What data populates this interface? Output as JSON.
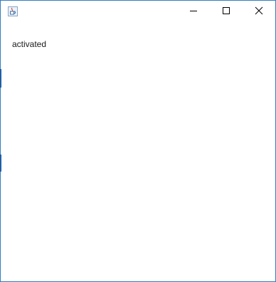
{
  "window": {
    "app_icon": "java-cup-icon",
    "controls": {
      "minimize": "minimize-icon",
      "maximize": "maximize-icon",
      "close": "close-icon"
    },
    "accent_color": "#2f7fc1"
  },
  "content": {
    "status_text": "activated"
  }
}
